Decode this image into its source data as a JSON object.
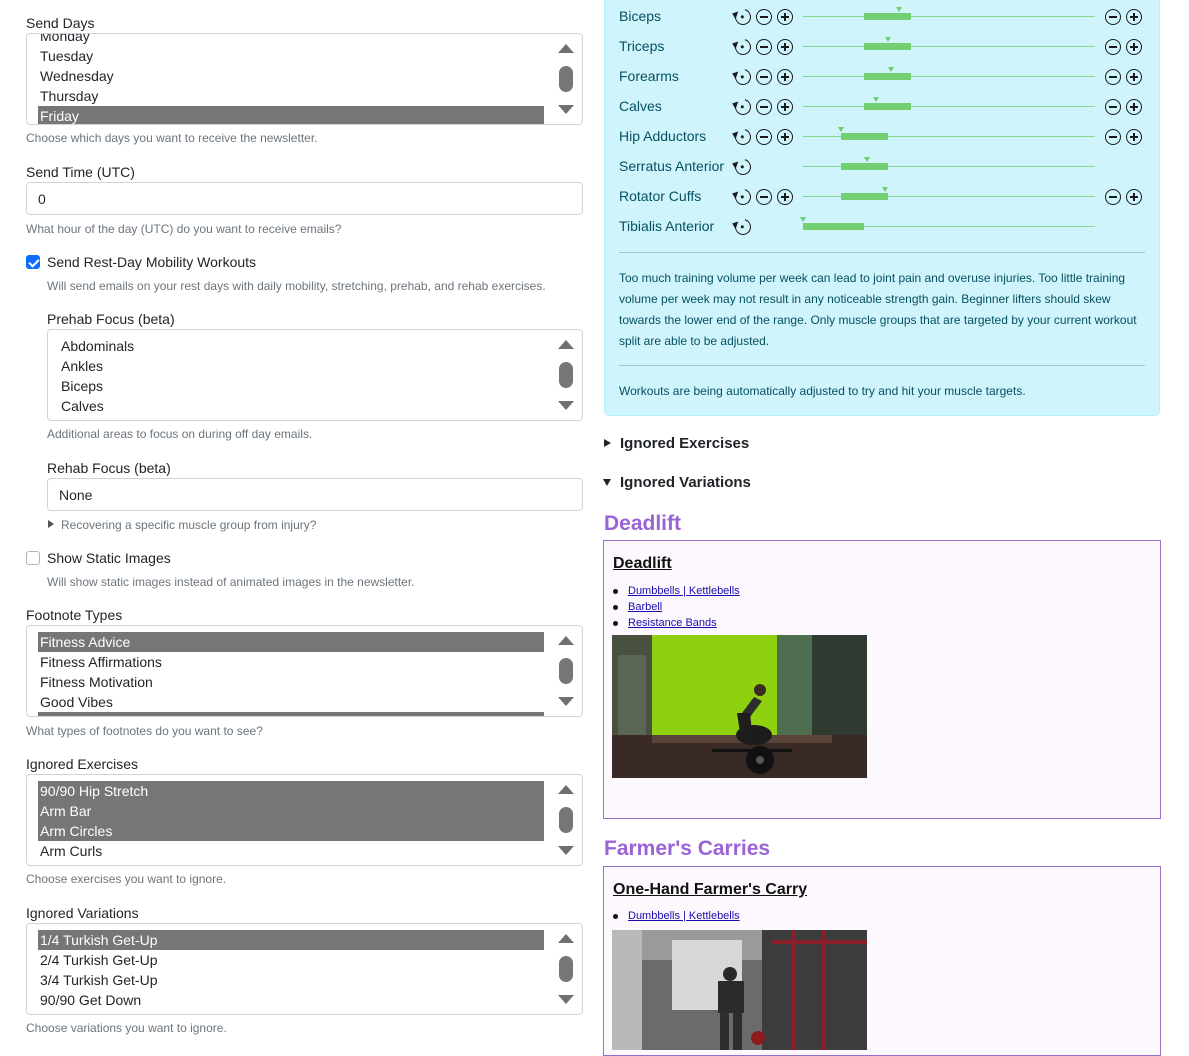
{
  "form": {
    "send_days": {
      "label": "Send Days",
      "options": [
        "Monday",
        "Tuesday",
        "Wednesday",
        "Thursday",
        "Friday"
      ],
      "selected": [
        "Friday"
      ],
      "help": "Choose which days you want to receive the newsletter."
    },
    "send_time": {
      "label": "Send Time (UTC)",
      "value": "0",
      "help": "What hour of the day (UTC) do you want to receive emails?"
    },
    "rest_day": {
      "label": "Send Rest-Day Mobility Workouts",
      "checked": true,
      "help": "Will send emails on your rest days with daily mobility, stretching, prehab, and rehab exercises."
    },
    "prehab": {
      "label": "Prehab Focus (beta)",
      "options": [
        "Abdominals",
        "Ankles",
        "Biceps",
        "Calves"
      ],
      "help": "Additional areas to focus on during off day emails."
    },
    "rehab": {
      "label": "Rehab Focus (beta)",
      "value": "None",
      "disclosure": "Recovering a specific muscle group from injury?"
    },
    "static_images": {
      "label": "Show Static Images",
      "checked": false,
      "help": "Will show static images instead of animated images in the newsletter."
    },
    "footnotes": {
      "label": "Footnote Types",
      "options": [
        "Fitness Advice",
        "Fitness Affirmations",
        "Fitness Motivation",
        "Good Vibes"
      ],
      "selected": [
        "Fitness Advice"
      ],
      "help": "What types of footnotes do you want to see?"
    },
    "ignored_exercises": {
      "label": "Ignored Exercises",
      "options": [
        "90/90 Hip Stretch",
        "Arm Bar",
        "Arm Circles",
        "Arm Curls"
      ],
      "selected": [
        "90/90 Hip Stretch",
        "Arm Bar",
        "Arm Circles"
      ],
      "help": "Choose exercises you want to ignore."
    },
    "ignored_variations": {
      "label": "Ignored Variations",
      "options": [
        "1/4 Turkish Get-Up",
        "2/4 Turkish Get-Up",
        "3/4 Turkish Get-Up",
        "90/90 Get Down"
      ],
      "selected": [
        "1/4 Turkish Get-Up"
      ],
      "help": "Choose variations you want to ignore."
    }
  },
  "muscle_targets": {
    "rows": [
      {
        "name": "Biceps",
        "range_start": 0.21,
        "range_end": 0.37,
        "marker": 0.33,
        "adjustable": true
      },
      {
        "name": "Triceps",
        "range_start": 0.21,
        "range_end": 0.37,
        "marker": 0.29,
        "adjustable": true
      },
      {
        "name": "Forearms",
        "range_start": 0.21,
        "range_end": 0.37,
        "marker": 0.3,
        "adjustable": true
      },
      {
        "name": "Calves",
        "range_start": 0.21,
        "range_end": 0.37,
        "marker": 0.25,
        "adjustable": true
      },
      {
        "name": "Hip Adductors",
        "range_start": 0.13,
        "range_end": 0.29,
        "marker": 0.13,
        "adjustable": true
      },
      {
        "name": "Serratus Anterior",
        "range_start": 0.13,
        "range_end": 0.29,
        "marker": 0.22,
        "adjustable": false
      },
      {
        "name": "Rotator Cuffs",
        "range_start": 0.13,
        "range_end": 0.29,
        "marker": 0.28,
        "adjustable": true
      },
      {
        "name": "Tibialis Anterior",
        "range_start": 0.0,
        "range_end": 0.21,
        "marker": 0.0,
        "adjustable": false
      }
    ],
    "info": "Too much training volume per week can lead to joint pain and overuse injuries. Too little training volume per week may not result in any noticeable strength gain. Beginner lifters should skew towards the lower end of the range. Only muscle groups that are targeted by your current workout split are able to be adjusted.",
    "status": "Workouts are being automatically adjusted to try and hit your muscle targets."
  },
  "right": {
    "ignored_exercises_summary": "Ignored Exercises",
    "ignored_variations_summary": "Ignored Variations",
    "sections": [
      {
        "title": "Deadlift",
        "card_title": "Deadlift",
        "links": [
          "Dumbbells | Kettlebells",
          "Barbell",
          "Resistance Bands"
        ]
      },
      {
        "title": "Farmer's Carries",
        "card_title": "One-Hand Farmer's Carry",
        "links": [
          "Dumbbells | Kettlebells"
        ]
      }
    ]
  },
  "colors": {
    "accent": "#9a63d6",
    "panel_bg": "#cff4fc",
    "target_bar": "#72cf72",
    "selected_option": "#767676",
    "checkbox": "#0d6efd"
  }
}
